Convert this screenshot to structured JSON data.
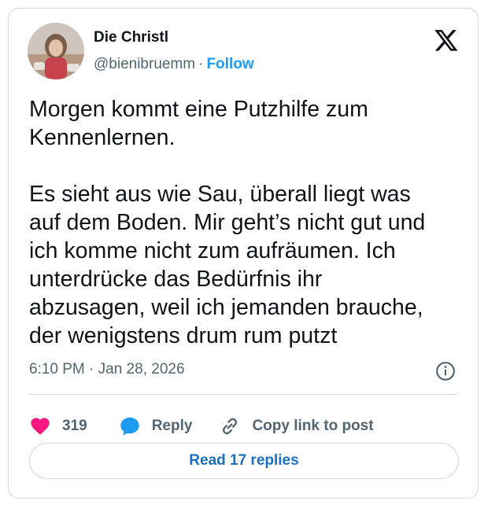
{
  "user": {
    "name": "Die Christl",
    "handle": "@bienibruemm",
    "separator": "·",
    "follow_label": "Follow"
  },
  "tweet": {
    "text": "Morgen kommt eine Putzhilfe zum\nKennenlernen.\n\nEs sieht aus wie Sau, überall liegt was\nauf dem Boden. Mir geht’s nicht gut und\nich komme nicht zum aufräumen. Ich\nunterdrücke das Bedürfnis ihr\nabzusagen, weil ich jemanden brauche,\nder wenigstens drum rum putzt",
    "timestamp": "6:10 PM · Jan 28, 2026"
  },
  "actions": {
    "like_count": "319",
    "reply_label": "Reply",
    "copy_label": "Copy link to post"
  },
  "footer": {
    "read_replies_label": "Read 17 replies"
  },
  "icons": {
    "logo": "x-logo-icon",
    "info": "info-icon",
    "like": "heart-icon",
    "reply": "speech-bubble-icon",
    "copy": "link-icon"
  },
  "colors": {
    "accent": "#1d9bf0",
    "like": "#f91880",
    "secondary_text": "#536471",
    "border": "#cfd9de"
  }
}
